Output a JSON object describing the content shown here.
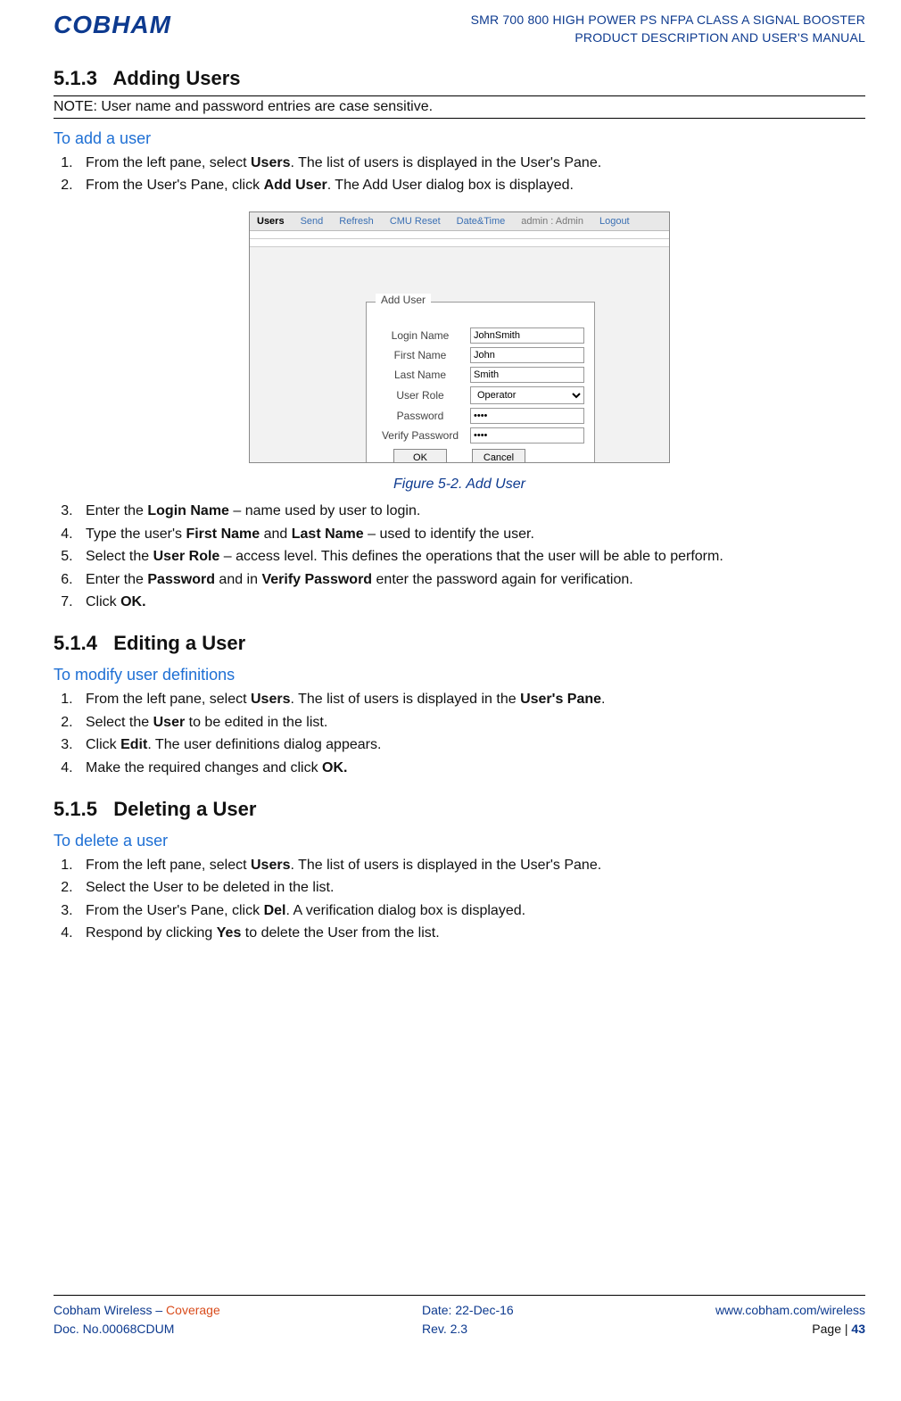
{
  "header": {
    "logo": "COBHAM",
    "line1": "SMR 700 800 HIGH POWER PS NFPA CLASS A SIGNAL BOOSTER",
    "line2": "PRODUCT DESCRIPTION AND USER'S MANUAL"
  },
  "section_5_1_3": {
    "num": "5.1.3",
    "title": "Adding Users",
    "note": "NOTE: User name and password entries are case sensitive.",
    "subhead": "To add a user",
    "step1_pre": "From the left pane, select ",
    "step1_b": "Users",
    "step1_post": ". The list of users is displayed in the User's Pane.",
    "step2_pre": "From the User's Pane, click ",
    "step2_b": "Add User",
    "step2_post": ". The Add User dialog box is displayed.",
    "figure": {
      "toolbar": {
        "users": "Users",
        "send": "Send",
        "refresh": "Refresh",
        "cmu_reset": "CMU Reset",
        "datetime": "Date&Time",
        "admin": "admin : Admin",
        "logout": "Logout"
      },
      "dialog": {
        "legend": "Add User",
        "login_name_lbl": "Login Name",
        "login_name_val": "JohnSmith",
        "first_name_lbl": "First Name",
        "first_name_val": "John",
        "last_name_lbl": "Last Name",
        "last_name_val": "Smith",
        "user_role_lbl": "User Role",
        "user_role_val": "Operator",
        "password_lbl": "Password",
        "password_val": "••••",
        "verify_password_lbl": "Verify Password",
        "verify_password_val": "••••",
        "ok": "OK",
        "cancel": "Cancel"
      },
      "caption": "Figure 5-2. Add User"
    },
    "step3_pre": "Enter the ",
    "step3_b": "Login Name",
    "step3_post": " – name used by user to login.",
    "step4_pre": "Type the user's ",
    "step4_b1": "First Name",
    "step4_mid": " and ",
    "step4_b2": "Last Name",
    "step4_post": " – used to identify the user.",
    "step5_pre": "Select the ",
    "step5_b": "User Role",
    "step5_post": " – access level. This defines the operations that the user will be able to perform.",
    "step6_pre": "Enter the ",
    "step6_b1": "Password",
    "step6_mid": " and in ",
    "step6_b2": "Verify Password",
    "step6_post": " enter the password again for verification.",
    "step7_pre": "Click ",
    "step7_b": "OK."
  },
  "section_5_1_4": {
    "num": "5.1.4",
    "title": "Editing a User",
    "subhead": "To modify user definitions",
    "step1_pre": "From the left pane, select ",
    "step1_b1": "Users",
    "step1_mid": ". The list of users is displayed in the ",
    "step1_b2": "User's Pane",
    "step1_post": ".",
    "step2_pre": "Select the ",
    "step2_b": "User",
    "step2_post": " to be edited in the list.",
    "step3_pre": "Click ",
    "step3_b": "Edit",
    "step3_post": ". The user definitions dialog appears.",
    "step4_pre": "Make the required changes and click ",
    "step4_b": "OK."
  },
  "section_5_1_5": {
    "num": "5.1.5",
    "title": "Deleting a User",
    "subhead": "To delete a user",
    "step1_pre": "From the left pane, select ",
    "step1_b": "Users",
    "step1_post": ". The list of users is displayed in the User's Pane.",
    "step2": "Select the User to be deleted in the list.",
    "step3_pre": "From the User's Pane, click ",
    "step3_b": "Del",
    "step3_post": ". A verification dialog box is displayed.",
    "step4_pre": "Respond by clicking ",
    "step4_b": "Yes",
    "step4_post": " to delete the User from the list."
  },
  "footer": {
    "left_line1_a": "Cobham Wireless – ",
    "left_line1_b": "Coverage",
    "left_line2": "Doc. No.00068CDUM",
    "mid_line1": "Date: 22-Dec-16",
    "mid_line2": "Rev. 2.3",
    "right_line1": "www.cobham.com/wireless",
    "right_line2_lbl": "Page | ",
    "right_line2_num": "43"
  }
}
